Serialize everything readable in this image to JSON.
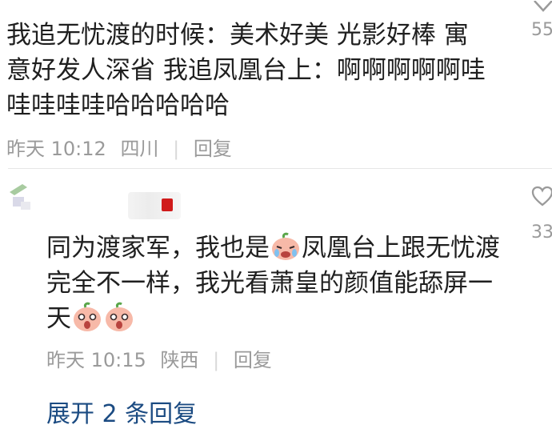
{
  "comment1": {
    "text": "我追无忧渡的时候：美术好美 光影好棒 寓意好发人深省 我追凤凰台上：啊啊啊啊啊哇哇哇哇哇哈哈哈哈哈",
    "time": "昨天 10:12",
    "location": "四川",
    "reply_label": "回复",
    "like_count": "55"
  },
  "comment2": {
    "text_part1": "同为渡家军，我也是",
    "text_part2": "凤凰台上跟无忧渡完全不一样，我光看萧皇的颜值能舔屏一天",
    "time": "昨天 10:15",
    "location": "陕西",
    "reply_label": "回复",
    "like_count": "33",
    "emojis": [
      "crying-peach-emoji",
      "shocked-peach-emoji",
      "shocked-peach-emoji"
    ]
  },
  "expand_replies": "展开 2 条回复",
  "icons": {
    "like": "heart-icon"
  },
  "colors": {
    "link": "#1b4b82",
    "meta": "#9a9a9a",
    "text": "#1f1f1f"
  }
}
